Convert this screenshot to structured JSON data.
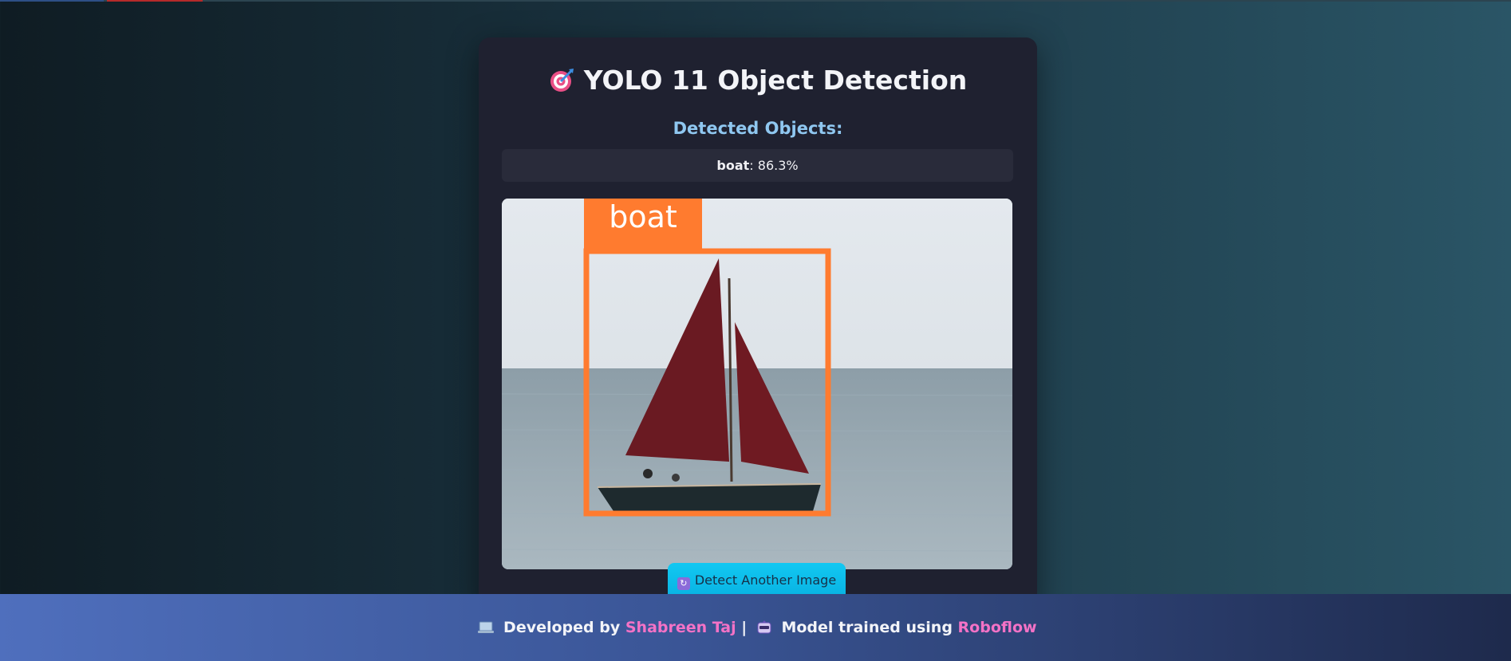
{
  "header": {
    "title": "YOLO 11 Object Detection",
    "title_icon": "target-icon"
  },
  "results": {
    "heading": "Detected Objects:",
    "items": [
      {
        "label": "boat",
        "confidence": "86.3%"
      }
    ]
  },
  "image": {
    "overlay_label": "boat"
  },
  "actions": {
    "detect_another_label": "Detect Another Image",
    "detect_another_icon": "refresh-icon"
  },
  "footer": {
    "developed_by_prefix": "Developed by",
    "developer_name": "Shabreen Taj",
    "separator": "|",
    "model_prefix": "Model trained using",
    "tool_name": "Roboflow",
    "laptop_icon": "laptop-icon",
    "robot_icon": "robot-icon"
  },
  "colors": {
    "accent_cyan": "#0ec1ee",
    "link_pink": "#f472c6",
    "heading_blue": "#8fc7f0",
    "box_orange": "#ff7b2f"
  }
}
